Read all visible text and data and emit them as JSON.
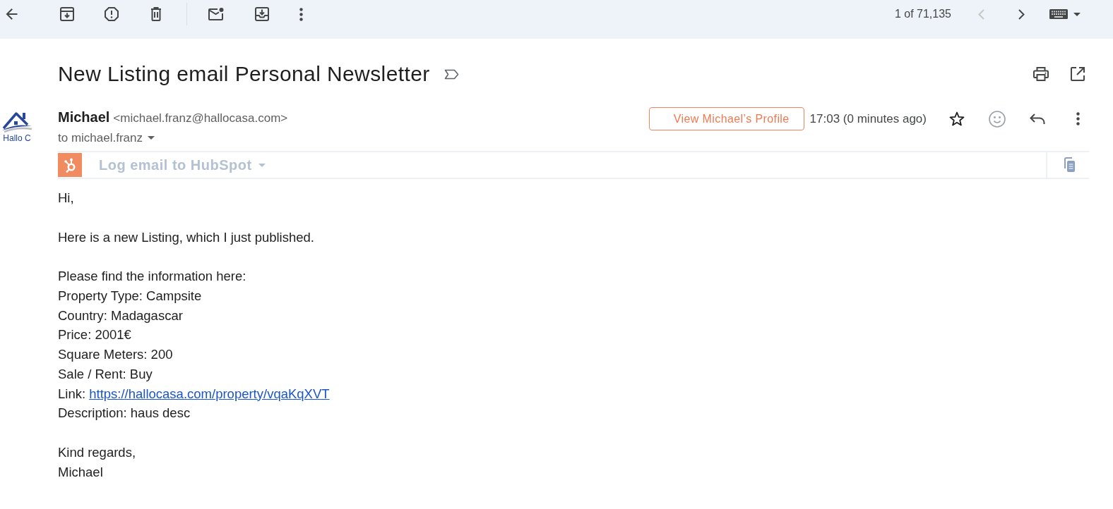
{
  "toolbar": {
    "pager": {
      "label": "1 of 71,135",
      "buttons": [
        {
          "kind": "previous",
          "disabled": true
        },
        {
          "kind": "next",
          "disabled": false
        }
      ]
    }
  },
  "message": {
    "subject": "New Listing email Personal Newsletter",
    "important": false,
    "avatar_text": "Hallo C",
    "sender": {
      "name": "Michael",
      "email": "<michael.franz@hallocasa.com>"
    },
    "recipients": "to michael.franz",
    "profile_button": "View Michael’s Profile",
    "time": "17:03 (0 minutes ago)",
    "starred": false
  },
  "hubspot": {
    "label": "Log email to HubSpot"
  },
  "body": {
    "paragraphs": [
      {
        "lines": [
          {
            "kind": "text",
            "text": "Hi,"
          }
        ]
      },
      {
        "lines": [
          {
            "kind": "text",
            "text": "Here is a new Listing, which I just published."
          }
        ]
      },
      {
        "lines": [
          {
            "kind": "text",
            "text": "Please find the information here:"
          },
          {
            "kind": "text",
            "text": "Property Type: Campsite"
          },
          {
            "kind": "text",
            "text": "Country: Madagascar"
          },
          {
            "kind": "text",
            "text": "Price: 2001€"
          },
          {
            "kind": "text",
            "text": "Square Meters: 200"
          },
          {
            "kind": "text",
            "text": "Sale / Rent: Buy"
          },
          {
            "kind": "link",
            "label": "Link:",
            "url": "https://hallocasa.com/property/vqaKqXVT"
          },
          {
            "kind": "text",
            "text": "Description: haus desc"
          }
        ]
      },
      {
        "lines": [
          {
            "kind": "text",
            "text": "Kind regards,"
          },
          {
            "kind": "text",
            "text": "Michael"
          }
        ]
      }
    ]
  }
}
